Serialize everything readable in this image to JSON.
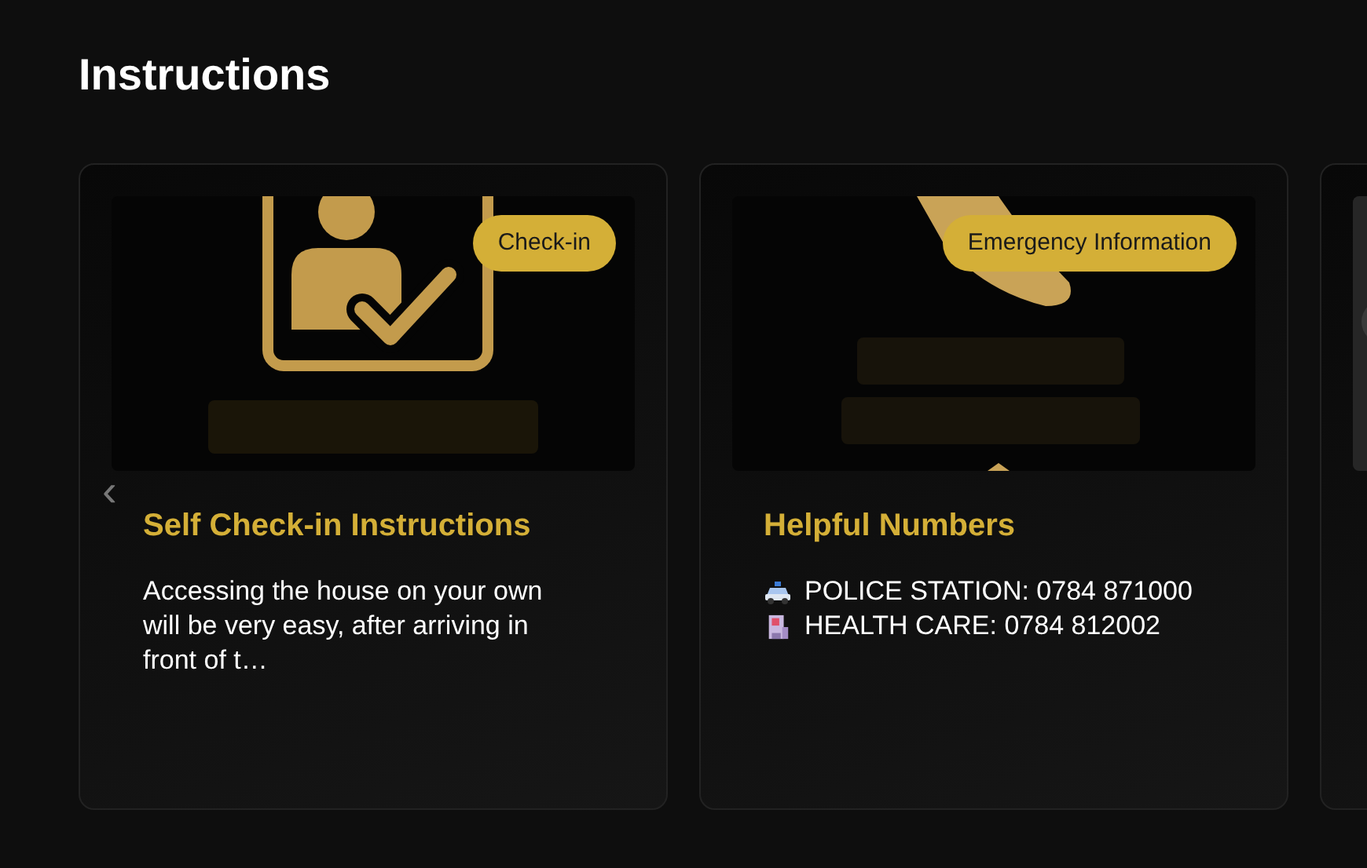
{
  "page_title": "Instructions",
  "carousel": {
    "prev_arrow": "‹"
  },
  "cards": [
    {
      "image": {
        "kind": "picture"
      },
      "badge": "Check-in",
      "title": "Self Check-in Instructions",
      "description": "Accessing the house on your own will be very easy, after arriving in front of t…"
    },
    {
      "image": {
        "kind": "picture"
      },
      "badge": "Emergency Information",
      "title": "Helpful Numbers",
      "contacts": [
        {
          "kind": "police",
          "text": "POLICE STATION: 0784 871000"
        },
        {
          "kind": "hospital",
          "text": "HEALTH CARE: 0784 812002"
        }
      ]
    },
    {
      "image": {
        "kind": "picture"
      }
    }
  ]
}
